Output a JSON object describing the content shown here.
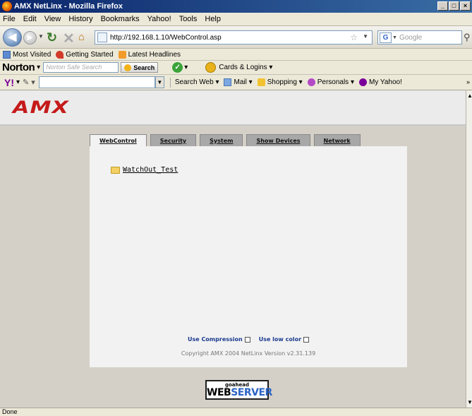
{
  "window": {
    "title": "AMX NetLinx - Mozilla Firefox",
    "controls": [
      "_",
      "□",
      "×"
    ]
  },
  "menu": [
    "File",
    "Edit",
    "View",
    "History",
    "Bookmarks",
    "Yahoo!",
    "Tools",
    "Help"
  ],
  "nav": {
    "url": "http://192.168.1.10/WebControl.asp",
    "search_placeholder": "Google",
    "search_engine_glyph": "G"
  },
  "bookmarks": [
    {
      "label": "Most Visited",
      "icon": "blue-bookmark-icon"
    },
    {
      "label": "Getting Started",
      "icon": "firefox-red-icon"
    },
    {
      "label": "Latest Headlines",
      "icon": "rss-feed-icon"
    }
  ],
  "norton": {
    "brand": "Norton",
    "search_placeholder": "Norton Safe Search",
    "search_button": "Search",
    "cards_label": "Cards & Logins"
  },
  "yahoo": {
    "logo": "Y!",
    "items": [
      {
        "label": "Search Web",
        "icon": "search-web-icon"
      },
      {
        "label": "Mail",
        "icon": "mail-icon"
      },
      {
        "label": "Shopping",
        "icon": "shopping-icon"
      },
      {
        "label": "Personals",
        "icon": "personals-icon"
      },
      {
        "label": "My Yahoo!",
        "icon": "my-yahoo-icon"
      }
    ]
  },
  "page": {
    "logo": "AMX",
    "tabs": [
      {
        "label": "WebControl",
        "active": true
      },
      {
        "label": "Security",
        "active": false
      },
      {
        "label": "System",
        "active": false
      },
      {
        "label": "Show Devices",
        "active": false
      },
      {
        "label": "Network",
        "active": false
      }
    ],
    "folder_link": "WatchOut_Test",
    "options": {
      "compression": "Use Compression",
      "low_color": "Use low color"
    },
    "copyright": "Copyright AMX 2004   NetLinx Version v2.31.139",
    "badge": {
      "top": "goahead",
      "web": "WEB",
      "server": "SERVER"
    }
  },
  "status": "Done",
  "colors": {
    "amx_red": "#c51a1a",
    "link_blue": "#1b3b8f",
    "server_blue": "#2c64c6"
  }
}
